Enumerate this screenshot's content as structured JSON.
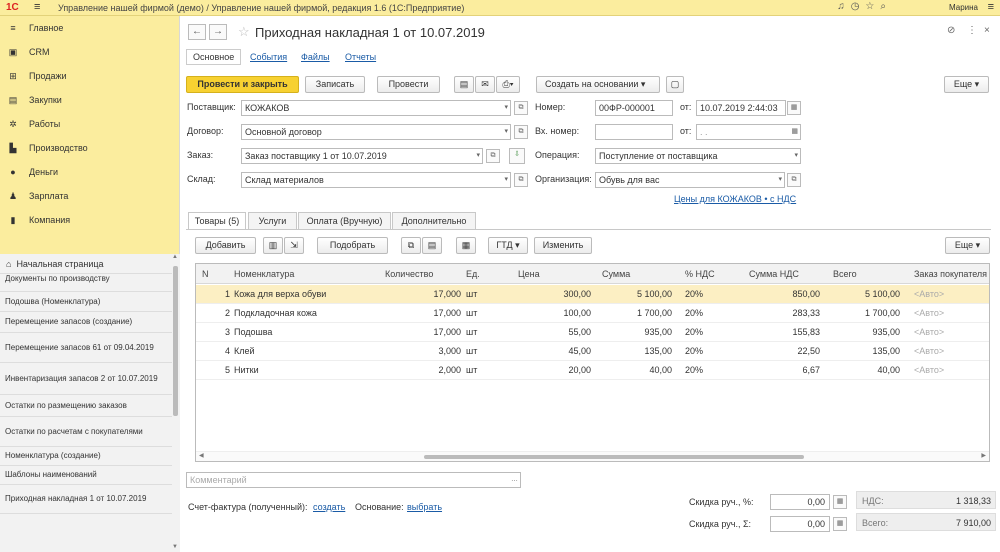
{
  "app": {
    "logo": "1С",
    "title": "Управление нашей фирмой (демо) / Управление нашей фирмой, редакция 1.6  (1С:Предприятие)",
    "user": "Марина"
  },
  "sidebar": {
    "sections": [
      {
        "label": "Главное",
        "icon": "menu-icon",
        "glyph": "≡"
      },
      {
        "label": "CRM",
        "icon": "crm-icon",
        "glyph": "▣"
      },
      {
        "label": "Продажи",
        "icon": "sales-icon",
        "glyph": "⊞"
      },
      {
        "label": "Закупки",
        "icon": "purchases-icon",
        "glyph": "▤"
      },
      {
        "label": "Работы",
        "icon": "works-icon",
        "glyph": "✲"
      },
      {
        "label": "Производство",
        "icon": "production-icon",
        "glyph": "▙"
      },
      {
        "label": "Деньги",
        "icon": "money-icon",
        "glyph": "●"
      },
      {
        "label": "Зарплата",
        "icon": "salary-icon",
        "glyph": "♟"
      },
      {
        "label": "Компания",
        "icon": "company-icon",
        "glyph": "▮"
      }
    ],
    "history": {
      "home_label": "Начальная страница",
      "items": [
        "Документы по производству",
        "Подошва (Номенклатура)",
        "Перемещение запасов (создание)",
        "Перемещение запасов 61 от 09.04.2019",
        "Инвентаризация запасов 2 от 10.07.2019",
        "Остатки по размещению заказов",
        "Остатки по расчетам с покупателями",
        "Номенклатура (создание)",
        "Шаблоны наименований",
        "Приходная накладная 1 от 10.07.2019"
      ]
    }
  },
  "doc": {
    "title": "Приходная накладная 1 от 10.07.2019",
    "tabs": [
      "Основное",
      "События",
      "Файлы",
      "Отчеты"
    ],
    "toolbar": {
      "post_close": "Провести и закрыть",
      "save": "Записать",
      "post": "Провести",
      "create_based": "Создать на основании",
      "more": "Еще"
    },
    "fields": {
      "supplier_label": "Поставщик:",
      "supplier": "КОЖАКОВ",
      "contract_label": "Договор:",
      "contract": "Основной договор",
      "order_label": "Заказ:",
      "order": "Заказ поставщику 1 от 10.07.2019",
      "warehouse_label": "Склад:",
      "warehouse": "Склад материалов",
      "number_label": "Номер:",
      "number": "00ФР-000001",
      "from_label": "от:",
      "date": "10.07.2019  2:44:03",
      "in_number_label": "Вх. номер:",
      "in_number": "",
      "in_from_label": "от:",
      "in_date": " .  .",
      "operation_label": "Операция:",
      "operation": "Поступление от поставщика",
      "org_label": "Организация:",
      "org": "Обувь для вас",
      "prices_link": "Цены для КОЖАКОВ • с НДС"
    },
    "inner_tabs": [
      "Товары (5)",
      "Услуги",
      "Оплата (Вручную)",
      "Дополнительно"
    ],
    "grid_toolbar": {
      "add": "Добавить",
      "pick": "Подобрать",
      "gtd": "ГТД",
      "change": "Изменить",
      "more": "Еще"
    },
    "columns": [
      "N",
      "Номенклатура",
      "Количество",
      "Ед.",
      "Цена",
      "Сумма",
      "% НДС",
      "Сумма НДС",
      "Всего",
      "Заказ покупателя"
    ],
    "rows": [
      {
        "n": "1",
        "name": "Кожа для верха обуви",
        "qty": "17,000",
        "unit": "шт",
        "price": "300,00",
        "sum": "5 100,00",
        "vat_rate": "20%",
        "vat": "850,00",
        "total": "5 100,00",
        "order": "<Авто>"
      },
      {
        "n": "2",
        "name": "Подкладочная кожа",
        "qty": "17,000",
        "unit": "шт",
        "price": "100,00",
        "sum": "1 700,00",
        "vat_rate": "20%",
        "vat": "283,33",
        "total": "1 700,00",
        "order": "<Авто>"
      },
      {
        "n": "3",
        "name": "Подошва",
        "qty": "17,000",
        "unit": "шт",
        "price": "55,00",
        "sum": "935,00",
        "vat_rate": "20%",
        "vat": "155,83",
        "total": "935,00",
        "order": "<Авто>"
      },
      {
        "n": "4",
        "name": "Клей",
        "qty": "3,000",
        "unit": "шт",
        "price": "45,00",
        "sum": "135,00",
        "vat_rate": "20%",
        "vat": "22,50",
        "total": "135,00",
        "order": "<Авто>"
      },
      {
        "n": "5",
        "name": "Нитки",
        "qty": "2,000",
        "unit": "шт",
        "price": "20,00",
        "sum": "40,00",
        "vat_rate": "20%",
        "vat": "6,67",
        "total": "40,00",
        "order": "<Авто>"
      }
    ],
    "footer": {
      "comment_placeholder": "Комментарий",
      "invoice_label": "Счет-фактура (полученный):",
      "invoice_link": "создать",
      "basis_label": "Основание:",
      "basis_link": "выбрать",
      "discount_pct_label": "Скидка руч., %:",
      "discount_pct": "0,00",
      "discount_sum_label": "Скидка руч., Σ:",
      "discount_sum": "0,00",
      "vat_label": "НДС:",
      "vat_total": "1 318,33",
      "total_label": "Всего:",
      "total": "7 910,00"
    }
  }
}
